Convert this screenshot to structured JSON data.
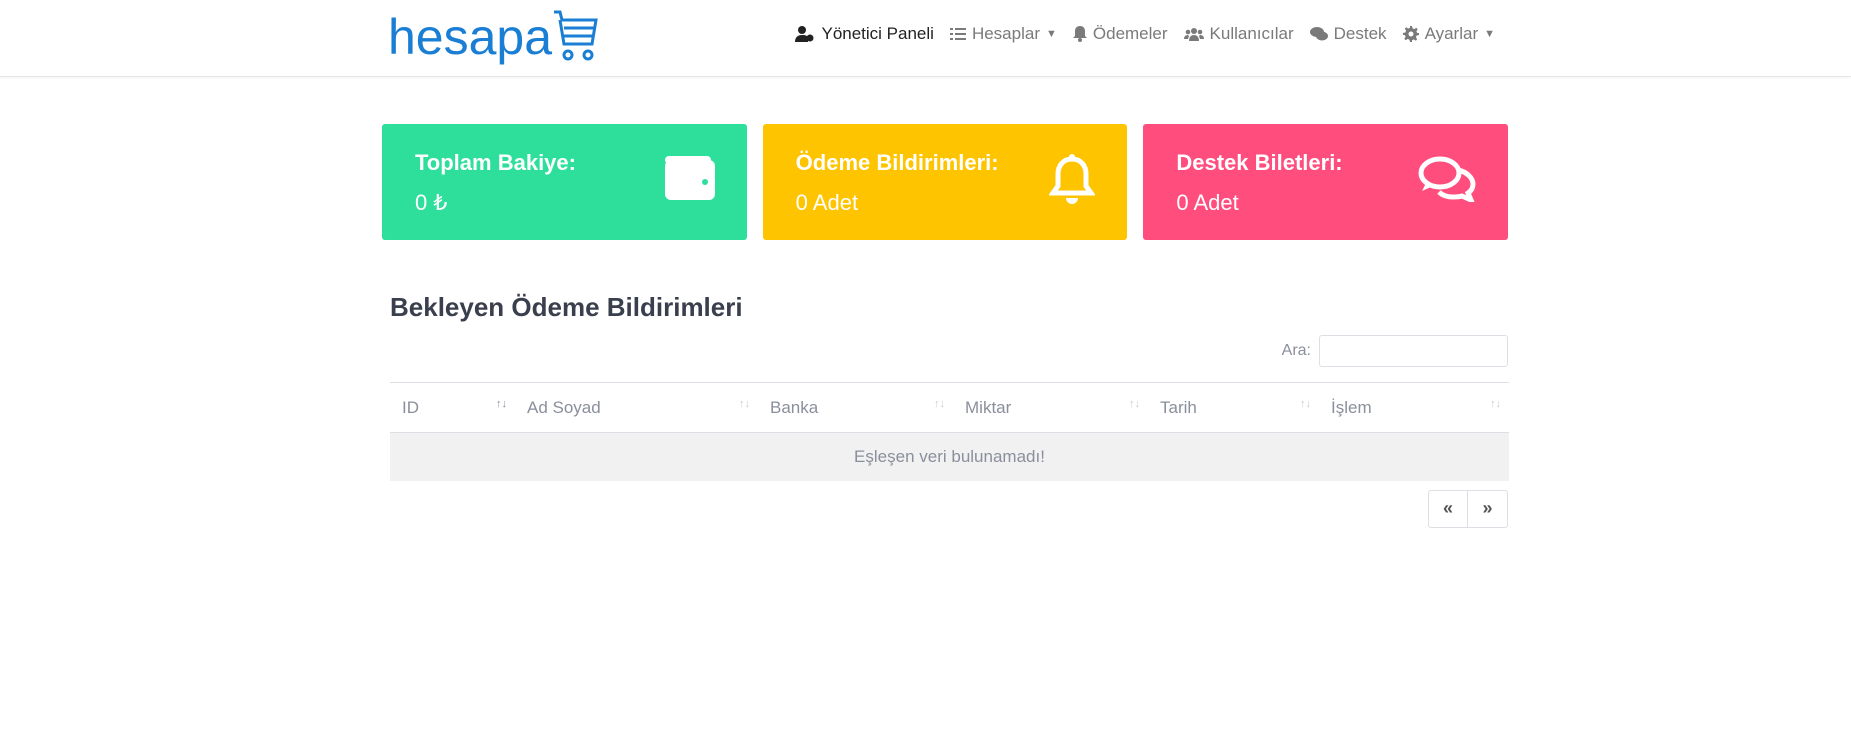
{
  "logo": {
    "text": "hesapa"
  },
  "nav": {
    "items": [
      {
        "label": "Yönetici Paneli",
        "icon": "user-gear-icon",
        "active": true
      },
      {
        "label": "Hesaplar",
        "icon": "list-icon",
        "dropdown": true
      },
      {
        "label": "Ödemeler",
        "icon": "bell-icon"
      },
      {
        "label": "Kullanıcılar",
        "icon": "users-icon"
      },
      {
        "label": "Destek",
        "icon": "comments-icon"
      },
      {
        "label": "Ayarlar",
        "icon": "gear-icon",
        "dropdown": true
      }
    ]
  },
  "cards": [
    {
      "title": "Toplam Bakiye:",
      "value": "0 ₺",
      "color": "#2edf9b",
      "icon": "wallet-icon"
    },
    {
      "title": "Ödeme Bildirimleri:",
      "value": "0 Adet",
      "color": "#ffc400",
      "icon": "bell-icon"
    },
    {
      "title": "Destek Biletleri:",
      "value": "0 Adet",
      "color": "#ff4d7d",
      "icon": "comments-icon"
    }
  ],
  "section": {
    "title": "Bekleyen Ödeme Bildirimleri",
    "search_label": "Ara:",
    "search_value": "",
    "columns": [
      "ID",
      "Ad Soyad",
      "Banka",
      "Miktar",
      "Tarih",
      "İşlem"
    ],
    "empty": "Eşleşen veri bulunamadı!",
    "pager": {
      "prev": "«",
      "next": "»"
    }
  }
}
